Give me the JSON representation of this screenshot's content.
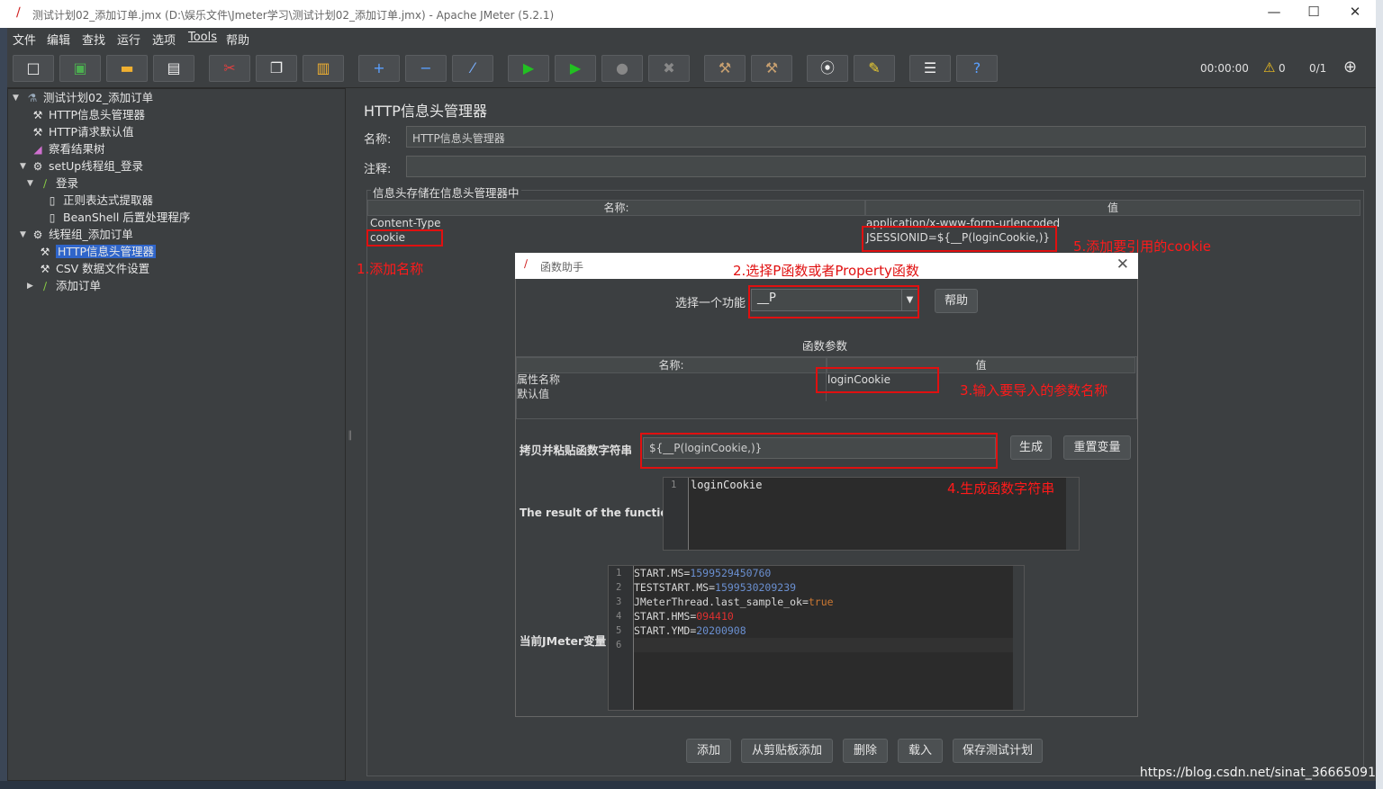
{
  "window": {
    "title": "测试计划02_添加订单.jmx (D:\\娱乐文件\\Jmeter学习\\测试计划02_添加订单.jmx) - Apache JMeter (5.2.1)",
    "minimize": "—",
    "maximize": "☐",
    "close": "✕"
  },
  "menu": [
    "文件",
    "编辑",
    "查找",
    "运行",
    "选项",
    "Tools",
    "帮助"
  ],
  "toolbar": {
    "elapsed": "00:00:00",
    "warnings": "0",
    "threads": "0/1"
  },
  "tree": {
    "items": [
      {
        "label": "测试计划02_添加订单",
        "icon": "flask-icon"
      },
      {
        "label": "HTTP信息头管理器",
        "icon": "wrench-icon"
      },
      {
        "label": "HTTP请求默认值",
        "icon": "wrench-icon"
      },
      {
        "label": "察看结果树",
        "icon": "chart-icon"
      },
      {
        "label": "setUp线程组_登录",
        "icon": "gear-icon"
      },
      {
        "label": "登录",
        "icon": "pipette-icon"
      },
      {
        "label": "正则表达式提取器",
        "icon": "document-icon"
      },
      {
        "label": "BeanShell 后置处理程序",
        "icon": "document-icon"
      },
      {
        "label": "线程组_添加订单",
        "icon": "gear-icon"
      },
      {
        "label": "HTTP信息头管理器",
        "icon": "wrench-icon"
      },
      {
        "label": "CSV 数据文件设置",
        "icon": "wrench-icon"
      },
      {
        "label": "添加订单",
        "icon": "pipette-icon"
      }
    ]
  },
  "panel": {
    "title": "HTTP信息头管理器",
    "name_label": "名称:",
    "name_value": "HTTP信息头管理器",
    "comment_label": "注释:",
    "comment_value": "",
    "group_title": "信息头存储在信息头管理器中",
    "headers_columns": [
      "名称:",
      "值"
    ],
    "headers_rows": [
      {
        "name": "Content-Type",
        "value": "application/x-www-form-urlencoded"
      },
      {
        "name": "cookie",
        "value": "JSESSIONID=${__P(loginCookie,)}"
      }
    ],
    "bottom_buttons": [
      "添加",
      "从剪贴板添加",
      "删除",
      "载入",
      "保存测试计划"
    ]
  },
  "dialog": {
    "title": "函数助手",
    "select_label": "选择一个功能",
    "selected_function": "__P",
    "help_button": "帮助",
    "params_title": "函数参数",
    "params_columns": [
      "名称:",
      "值"
    ],
    "params_rows": [
      {
        "name": "属性名称",
        "value": "loginCookie"
      },
      {
        "name": "默认值",
        "value": ""
      }
    ],
    "copy_label": "拷贝并粘贴函数字符串",
    "function_string": "${__P(loginCookie,)}",
    "generate_button": "生成",
    "reset_button": "重置变量",
    "result_label": "The result of the function is",
    "result_lines": [
      "loginCookie"
    ],
    "vars_label": "当前JMeter变量",
    "vars_lines": [
      {
        "key": "START.MS",
        "val": "1599529450760"
      },
      {
        "key": "TESTSTART.MS",
        "val": "1599530209239"
      },
      {
        "key": "JMeterThread.last_sample_ok",
        "val": "true"
      },
      {
        "key": "START.HMS",
        "val": "094410"
      },
      {
        "key": "START.YMD",
        "val": "20200908"
      },
      {
        "key": "",
        "val": ""
      }
    ]
  },
  "annotations": {
    "a1": "1.添加名称",
    "a2": "2.选择P函数或者Property函数",
    "a3": "3.输入要导入的参数名称",
    "a4": "4.生成函数字符串",
    "a5": "5.添加要引用的cookie"
  },
  "watermark": "https://blog.csdn.net/sinat_36665091"
}
